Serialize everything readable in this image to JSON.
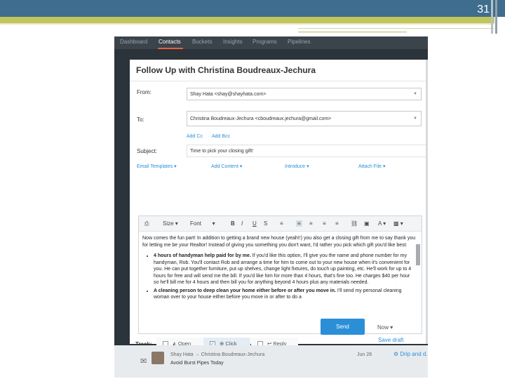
{
  "slide": {
    "number": "31"
  },
  "nav": {
    "tabs": [
      "Dashboard",
      "Contacts",
      "Buckets",
      "Insights",
      "Programs",
      "Pipelines"
    ],
    "active": "Contacts"
  },
  "modal": {
    "title": "Follow Up with Christina Boudreaux-Jechura",
    "from_label": "From:",
    "from_value": "Shay Hata <shay@shayhata.com>",
    "to_label": "To:",
    "to_value": "Christina Boudreaux-Jechura <cboudreaux.jechura@gmail.com>",
    "add_cc": "Add Cc",
    "add_bcc": "Add Bcc",
    "subject_label": "Subject:",
    "subject_value": "Time to pick your closing gift!",
    "tools": {
      "email_templates": "Email Templates ▾",
      "add_content": "Add Content ▾",
      "introduce": "Introduce ▾",
      "attach_file": "Attach File ▾"
    },
    "toolbar": {
      "size": "Size",
      "font": "Font"
    },
    "body": {
      "intro": "Now comes the fun part! In addition to getting a brand new house (yeah!!) you also get a closing gift from me to say thank you for letting me be your Realtor! Instead of giving you something you don't want, I'd rather you pick which gift you'd like best:",
      "item1_bold": "4 hours of handyman help paid for by me.",
      "item1_rest": " If you'd like this option, I'll give you the name and phone number for my handyman, Rob. You'll contact Rob and arrange a time for him to come out to your new house when it's convenient for you. He can put together furniture, put up shelves, change light fixtures, do touch up painting, etc. He'll work for up to 4 hours for free and will send me the bill. If you'd like him for more than 4 hours, that's fine too. He charges $40 per hour so he'll bill me for 4 hours and then bill you for anything beyond 4 hours plus any materials needed.",
      "item2_bold": "A cleaning person to deep clean your home either before or after you move in.",
      "item2_rest": " I'll send my personal cleaning woman over to your house either before you move in or after to do a"
    },
    "track": {
      "label": "Track:",
      "open": "Open",
      "click": "Click",
      "reply": "Reply"
    },
    "send": "Send",
    "now": "Now ▾",
    "save_draft": "Save draft"
  },
  "bottom": {
    "line1": "Shay Hata → Christina Boudreaux-Jechura",
    "line2": "Avoid Burst Pipes Today",
    "date": "Jun 28",
    "link": "Drip and d..."
  }
}
